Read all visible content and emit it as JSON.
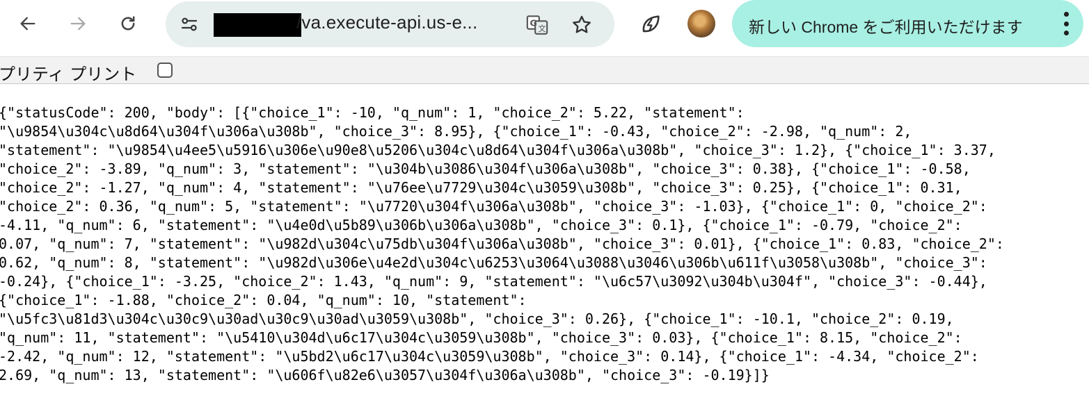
{
  "browser": {
    "url_suffix": "/va.execute-api.us-e...",
    "update_banner": "新しい Chrome をご利用いただけます",
    "icons": {
      "back": "arrow-left-icon",
      "forward": "arrow-right-icon",
      "reload": "reload-icon",
      "site_info": "tune-icon",
      "translate": "translate-icon",
      "bookmark": "star-icon",
      "extension": "leaf-bolt-icon",
      "menu": "kebab-menu-icon"
    },
    "colors": {
      "omnibox": "#e6efed",
      "update_pill": "#a8f0e3"
    }
  },
  "pretty_print": {
    "label": "プリティ プリント",
    "checked": false
  },
  "json_lines": [
    "{\"statusCode\": 200, \"body\": [{\"choice_1\": -10, \"q_num\": 1, \"choice_2\": 5.22, \"statement\":",
    "\"\\u9854\\u304c\\u8d64\\u304f\\u306a\\u308b\", \"choice_3\": 8.95}, {\"choice_1\": -0.43, \"choice_2\": -2.98, \"q_num\": 2,",
    "\"statement\": \"\\u9854\\u4ee5\\u5916\\u306e\\u90e8\\u5206\\u304c\\u8d64\\u304f\\u306a\\u308b\", \"choice_3\": 1.2}, {\"choice_1\": 3.37,",
    "\"choice_2\": -3.89, \"q_num\": 3, \"statement\": \"\\u304b\\u3086\\u304f\\u306a\\u308b\", \"choice_3\": 0.38}, {\"choice_1\": -0.58,",
    "\"choice_2\": -1.27, \"q_num\": 4, \"statement\": \"\\u76ee\\u7729\\u304c\\u3059\\u308b\", \"choice_3\": 0.25}, {\"choice_1\": 0.31,",
    "\"choice_2\": 0.36, \"q_num\": 5, \"statement\": \"\\u7720\\u304f\\u306a\\u308b\", \"choice_3\": -1.03}, {\"choice_1\": 0, \"choice_2\":",
    "-4.11, \"q_num\": 6, \"statement\": \"\\u4e0d\\u5b89\\u306b\\u306a\\u308b\", \"choice_3\": 0.1}, {\"choice_1\": -0.79, \"choice_2\":",
    "0.07, \"q_num\": 7, \"statement\": \"\\u982d\\u304c\\u75db\\u304f\\u306a\\u308b\", \"choice_3\": 0.01}, {\"choice_1\": 0.83, \"choice_2\":",
    "0.62, \"q_num\": 8, \"statement\": \"\\u982d\\u306e\\u4e2d\\u304c\\u6253\\u3064\\u3088\\u3046\\u306b\\u611f\\u3058\\u308b\", \"choice_3\":",
    "-0.24}, {\"choice_1\": -3.25, \"choice_2\": 1.43, \"q_num\": 9, \"statement\": \"\\u6c57\\u3092\\u304b\\u304f\", \"choice_3\": -0.44},",
    "{\"choice_1\": -1.88, \"choice_2\": 0.04, \"q_num\": 10, \"statement\":",
    "\"\\u5fc3\\u81d3\\u304c\\u30c9\\u30ad\\u30c9\\u30ad\\u3059\\u308b\", \"choice_3\": 0.26}, {\"choice_1\": -10.1, \"choice_2\": 0.19,",
    "\"q_num\": 11, \"statement\": \"\\u5410\\u304d\\u6c17\\u304c\\u3059\\u308b\", \"choice_3\": 0.03}, {\"choice_1\": 8.15, \"choice_2\":",
    "-2.42, \"q_num\": 12, \"statement\": \"\\u5bd2\\u6c17\\u304c\\u3059\\u308b\", \"choice_3\": 0.14}, {\"choice_1\": -4.34, \"choice_2\":",
    "2.69, \"q_num\": 13, \"statement\": \"\\u606f\\u82e6\\u3057\\u304f\\u306a\\u308b\", \"choice_3\": -0.19}]}"
  ]
}
